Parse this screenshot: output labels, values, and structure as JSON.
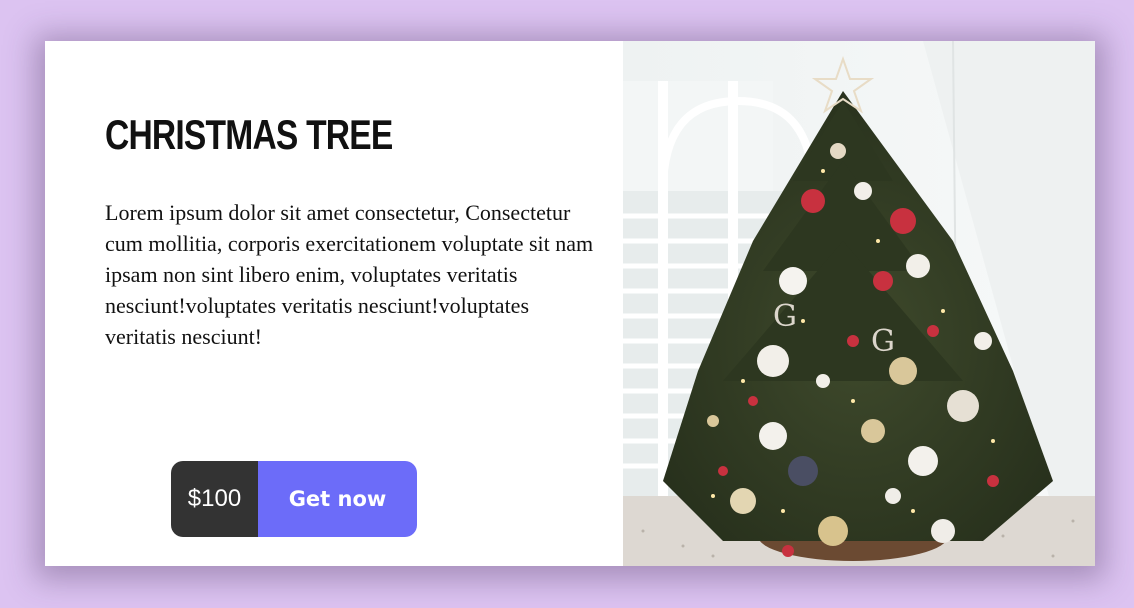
{
  "product": {
    "title": "Christmas tree",
    "description": "Lorem ipsum dolor sit amet consectetur, Consectetur cum mollitia, corporis exercitationem voluptate sit nam ipsam non sint libero enim, voluptates veritatis nesciunt!voluptates veritatis nesciunt!voluptates veritatis nesciunt!",
    "price": "$100",
    "cta_label": "Get now",
    "image_icon": "christmas-tree-photo"
  },
  "colors": {
    "background": "#dcc3f1",
    "card": "#ffffff",
    "price_bg": "#333333",
    "cta_bg": "#6c6cf9"
  }
}
